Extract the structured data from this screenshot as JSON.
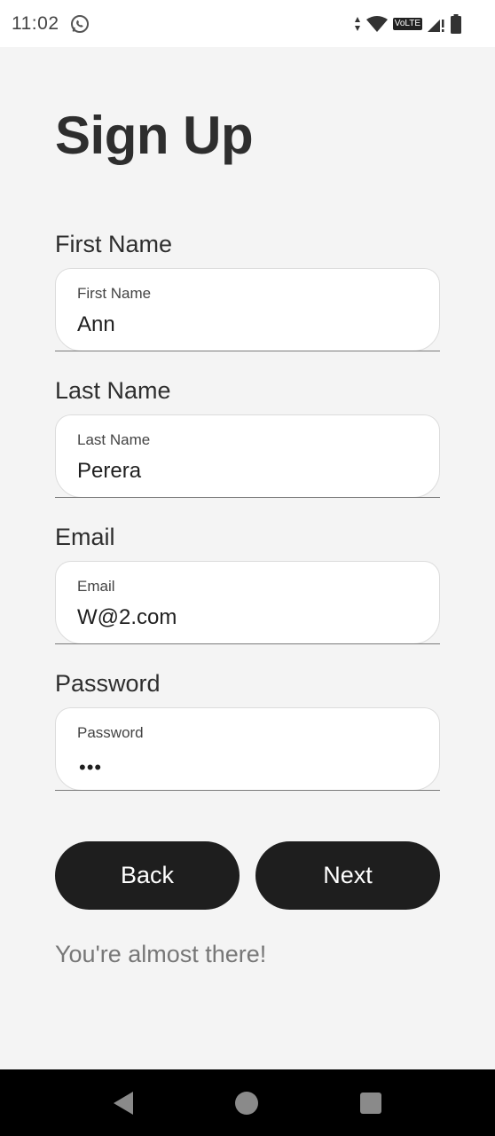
{
  "status_bar": {
    "time": "11:02",
    "notification_icon": "whatsapp-icon",
    "volte": "VoLTE",
    "icons": [
      "data-arrows-icon",
      "wifi-icon",
      "signal-icon",
      "battery-icon"
    ]
  },
  "page": {
    "title": "Sign Up",
    "footer": "You're almost there!"
  },
  "fields": {
    "first_name": {
      "label": "First Name",
      "float_label": "First Name",
      "value": "Ann"
    },
    "last_name": {
      "label": "Last Name",
      "float_label": "Last Name",
      "value": "Perera"
    },
    "email": {
      "label": "Email",
      "float_label": "Email",
      "value": "W@2.com"
    },
    "password": {
      "label": "Password",
      "float_label": "Password",
      "value": "•••"
    }
  },
  "buttons": {
    "back": "Back",
    "next": "Next"
  },
  "colors": {
    "background": "#f4f4f4",
    "button": "#1e1e1e",
    "field": "#ffffff"
  },
  "nav_bar": {
    "icons": [
      "back-nav-icon",
      "home-nav-icon",
      "recents-nav-icon"
    ]
  }
}
